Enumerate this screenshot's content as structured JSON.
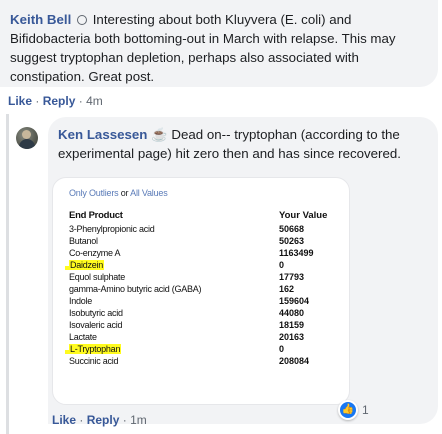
{
  "comment1": {
    "author": "Keith Bell",
    "author_icon": "badge-icon",
    "text": "Interesting about both Kluyvera (E. coli) and Bifidobacteria both bottoming-out in March with relapse. This may suggest tryptophan depletion, perhaps also associated with constipation. Great post.",
    "actions": {
      "like": "Like",
      "reply": "Reply",
      "separator": "·",
      "time": "4m"
    }
  },
  "comment2": {
    "author": "Ken Lassesen",
    "author_icon": "coffee-icon",
    "text": "Dead on-- tryptophan (according to the experimental page) hit zero then and has since recovered.",
    "actions": {
      "like": "Like",
      "reply": "Reply",
      "separator": "·",
      "time": "1m"
    },
    "reaction": {
      "icon": "thumbs-up-icon",
      "count": "1"
    }
  },
  "attachment": {
    "filter": {
      "only_outliers": "Only Outliers",
      "or": "or",
      "all_values": "All Values"
    },
    "headers": {
      "end_product": "End Product",
      "your_value": "Your Value"
    },
    "rows": [
      {
        "name": "3-Phenylpropionic acid",
        "value": "50668",
        "highlight": false
      },
      {
        "name": "Butanol",
        "value": "50263",
        "highlight": false
      },
      {
        "name": "Co-enzyme A",
        "value": "1163499",
        "highlight": false
      },
      {
        "name": "Daidzein",
        "value": "0",
        "highlight": true
      },
      {
        "name": "Equol sulphate",
        "value": "17793",
        "highlight": false
      },
      {
        "name": "gamma-Amino butyric acid (GABA)",
        "value": "162",
        "highlight": false
      },
      {
        "name": "Indole",
        "value": "159604",
        "highlight": false
      },
      {
        "name": "Isobutyric acid",
        "value": "44080",
        "highlight": false
      },
      {
        "name": "Isovaleric acid",
        "value": "18159",
        "highlight": false
      },
      {
        "name": "Lactate",
        "value": "20163",
        "highlight": false
      },
      {
        "name": "L-Tryptophan",
        "value": "0",
        "highlight": true
      },
      {
        "name": "Succinic acid",
        "value": "208084",
        "highlight": false
      }
    ],
    "highlight_color": "#fffb1f"
  },
  "colors": {
    "link": "#385898",
    "bubble": "#f2f3f5",
    "like_blue": "#1877f2"
  }
}
